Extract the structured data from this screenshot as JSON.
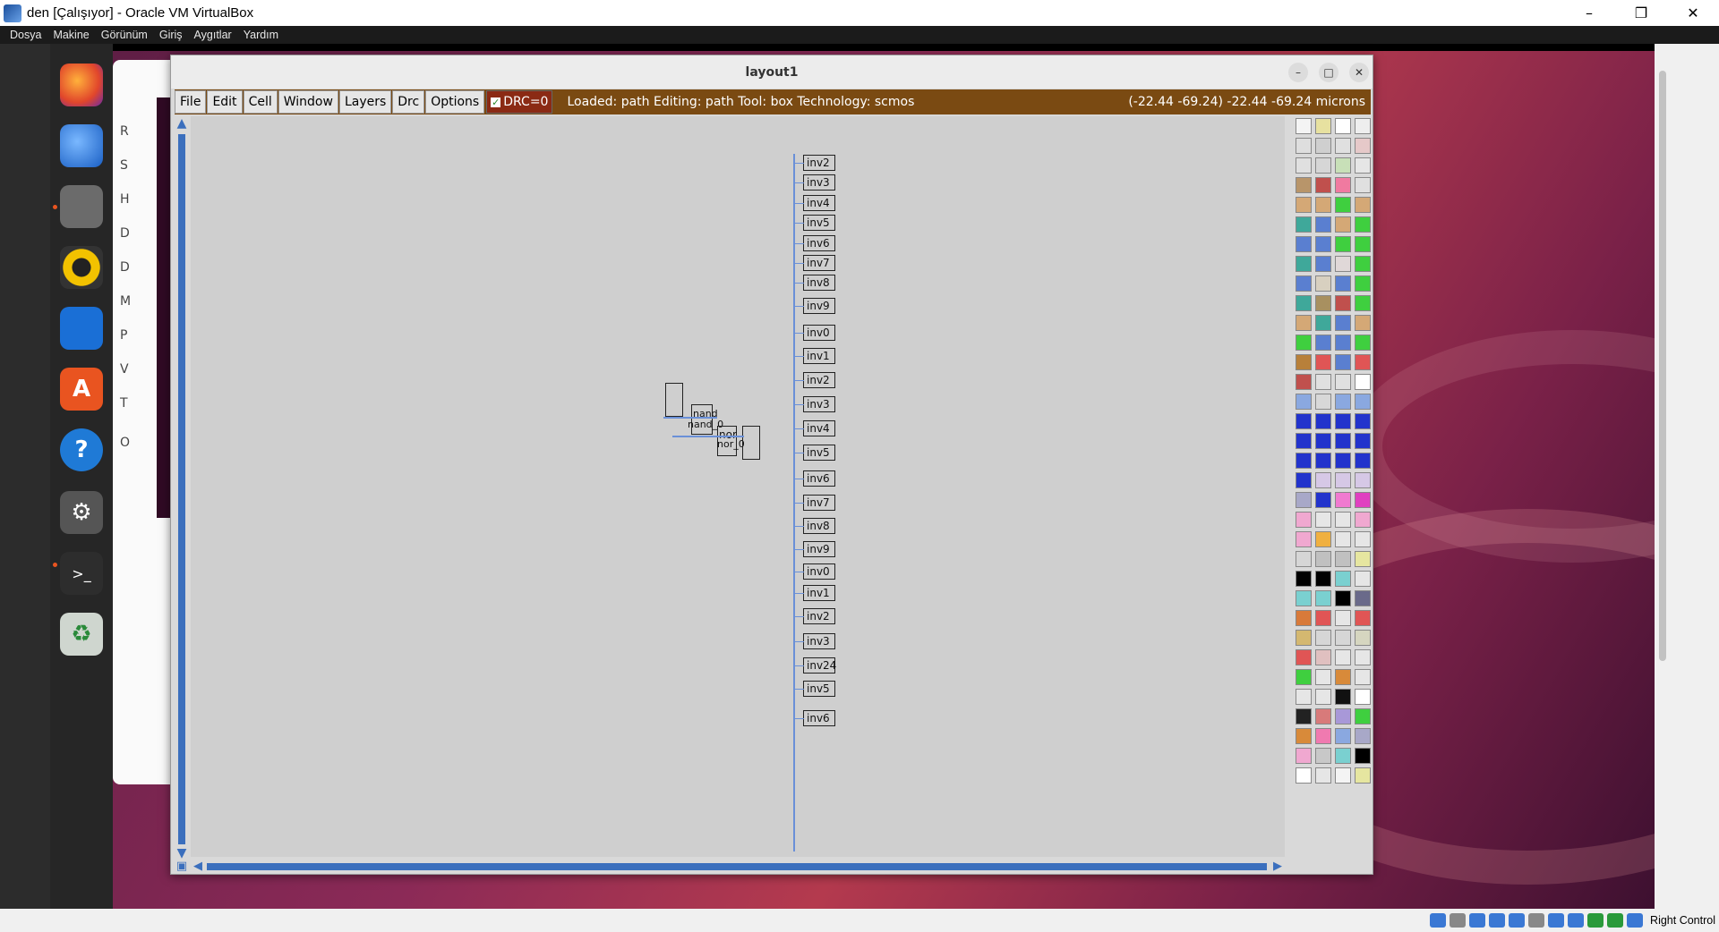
{
  "host": {
    "window_title": "den [Çalışıyor] - Oracle VM VirtualBox",
    "menu": [
      "Dosya",
      "Makine",
      "Görünüm",
      "Giriş",
      "Aygıtlar",
      "Yardım"
    ],
    "right_control_label": "Right Control"
  },
  "files_sidebar": {
    "items": [
      "R",
      "S",
      "H",
      "D",
      "D",
      "M",
      "P",
      "V",
      "T",
      "O"
    ]
  },
  "magic": {
    "window_title": "layout1",
    "menu": [
      "File",
      "Edit",
      "Cell",
      "Window",
      "Layers",
      "Drc",
      "Options"
    ],
    "drc_label": "DRC=0",
    "status_text": "Loaded: path Editing: path Tool: box  Technology: scmos",
    "coords_text": "(-22.44 -69.24) -22.44 -69.24 microns",
    "cells": {
      "nand_label": "nand",
      "nand_instance": "nand_0",
      "nor_label": "nor",
      "nor_instance": "nor_0",
      "inverters": [
        "inv2",
        "inv3",
        "inv4",
        "inv5",
        "inv6",
        "inv7",
        "inv8",
        "inv9",
        "inv0",
        "inv1",
        "inv2",
        "inv3",
        "inv4",
        "inv5",
        "inv6",
        "inv7",
        "inv8",
        "inv9",
        "inv0",
        "inv1",
        "inv2",
        "inv3",
        "inv24",
        "inv5",
        "inv6"
      ]
    }
  },
  "palette_colors": [
    "#f4f4f4",
    "#e7e1a0",
    "#ffffff",
    "#eeeeee",
    "#dedede",
    "#cfcfcf",
    "#e0e0e0",
    "#e6c9c9",
    "#e0e0e0",
    "#d6d6d6",
    "#c8e0b8",
    "#e6e6e6",
    "#b8956a",
    "#c0504d",
    "#f07aa0",
    "#e0e0e0",
    "#d4a876",
    "#d4a876",
    "#3fcf3f",
    "#d4a876",
    "#3fa89a",
    "#5a7fd0",
    "#d4a876",
    "#3fcf3f",
    "#5a7fd0",
    "#5a7fd0",
    "#3fcf3f",
    "#3fcf3f",
    "#3fa89a",
    "#5a7fd0",
    "#e0d8d8",
    "#3fcf3f",
    "#5a7fd0",
    "#d8d0c0",
    "#5a7fd0",
    "#3fcf3f",
    "#3fa89a",
    "#a89060",
    "#c0504d",
    "#3fcf3f",
    "#d4a876",
    "#3fa89a",
    "#5a7fd0",
    "#d4a876",
    "#3fcf3f",
    "#5a7fd0",
    "#5a7fd0",
    "#3fcf3f",
    "#b8803a",
    "#e05555",
    "#5a7fd0",
    "#e05555",
    "#c0504d",
    "#e0e0e0",
    "#e0e0e0",
    "#ffffff",
    "#8aa8e0",
    "#d8d8d8",
    "#8aa8e0",
    "#8aa8e0",
    "#2233cc",
    "#2233cc",
    "#2233cc",
    "#2233cc",
    "#2233cc",
    "#2233cc",
    "#2233cc",
    "#2233cc",
    "#2233cc",
    "#2233cc",
    "#2233cc",
    "#2233cc",
    "#2233cc",
    "#d6c8e6",
    "#d6c8e6",
    "#d6c8e6",
    "#a8a8c8",
    "#2233cc",
    "#f07ad0",
    "#e040c0",
    "#f0a8d0",
    "#e6e6e6",
    "#e6e6e6",
    "#f0a8d0",
    "#f0a8d0",
    "#f0b040",
    "#e6e6e6",
    "#e6e6e6",
    "#d6d6d6",
    "#c0c0c0",
    "#c0c0c0",
    "#e6e6a0",
    "#000000",
    "#000000",
    "#7ad0d0",
    "#e6e6e6",
    "#7ad0d0",
    "#7ad0d0",
    "#000000",
    "#6a6a8a",
    "#d87a3a",
    "#e05555",
    "#e6e6e6",
    "#e05555",
    "#d4b870",
    "#d6d6d6",
    "#d6d6d6",
    "#d6d6c0",
    "#e05555",
    "#e0c0c0",
    "#e6e6e6",
    "#e6e6e6",
    "#3fcf3f",
    "#e6e6e6",
    "#d88a3a",
    "#e6e6e6",
    "#e6e6e6",
    "#e6e6e6",
    "#111111",
    "#ffffff",
    "#222222",
    "#d87a7a",
    "#a898d8",
    "#3fcf3f",
    "#d88a3a",
    "#f07ab0",
    "#8aa8e0",
    "#a8a8c8",
    "#f0a8d0",
    "#c8c8c8",
    "#7ad0d0",
    "#000000",
    "#ffffff",
    "#e6e6e6",
    "#f4f4f4",
    "#e6e6a0"
  ]
}
